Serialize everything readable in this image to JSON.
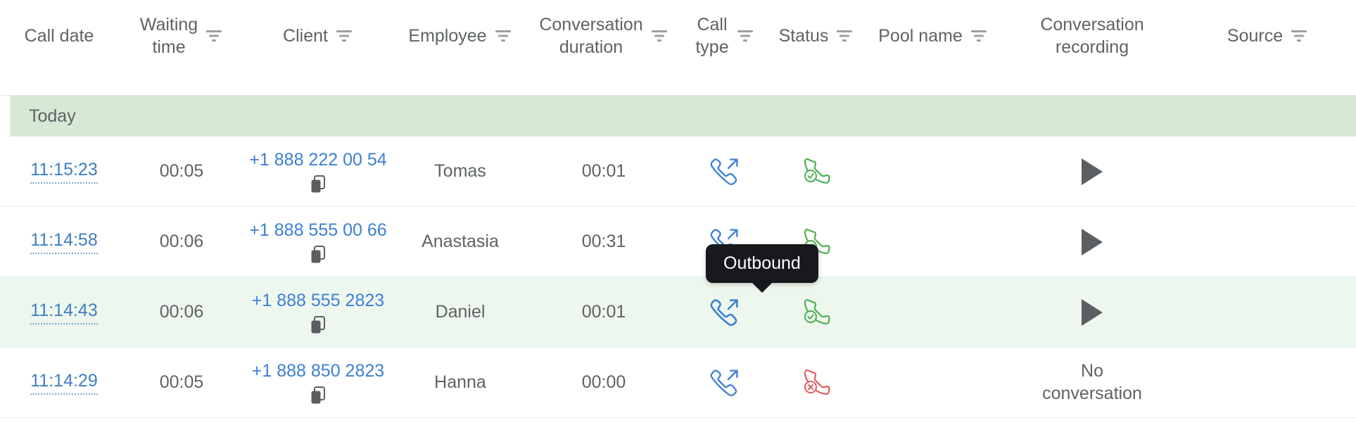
{
  "colors": {
    "link_blue": "#3d7fd4",
    "group_green": "#d7e9d5",
    "row_hover_green": "#eef7ee",
    "status_answered": "#4caf50",
    "status_missed": "#e25c5c",
    "text_gray": "#5e6366",
    "tooltip_bg": "#17191c"
  },
  "table": {
    "columns": [
      {
        "label": "Call date",
        "key": "call_date",
        "filter_icon": null,
        "filterable": false
      },
      {
        "label": "Waiting\ntime",
        "key": "waiting",
        "filter_icon": "filter-icon",
        "filterable": true
      },
      {
        "label": "Client",
        "key": "client",
        "filter_icon": "filter-icon",
        "filterable": true
      },
      {
        "label": "Employee",
        "key": "employee",
        "filter_icon": "filter-icon",
        "filterable": true
      },
      {
        "label": "Conversation\nduration",
        "key": "duration",
        "filter_icon": "filter-icon",
        "filterable": true
      },
      {
        "label": "Call\ntype",
        "key": "call_type",
        "filter_icon": "filter-icon",
        "filterable": true
      },
      {
        "label": "Status",
        "key": "status",
        "filter_icon": "filter-icon",
        "filterable": true
      },
      {
        "label": "Pool name",
        "key": "pool_name",
        "filter_icon": "filter-icon",
        "filterable": true
      },
      {
        "label": "Conversation\nrecording",
        "key": "recording",
        "filter_icon": null,
        "filterable": false
      },
      {
        "label": "Source",
        "key": "source",
        "filter_icon": "filter-icon",
        "filterable": true
      }
    ],
    "groups": [
      {
        "label": "Today"
      }
    ],
    "rows": [
      {
        "call_date": "11:15:23",
        "waiting": "00:05",
        "client": "+1 888 222 00 54",
        "copy_icon": "copy-icon",
        "employee": "Tomas",
        "duration": "00:01",
        "call_type_icon": "outbound-call-icon",
        "call_type_label": "Outbound",
        "status_icon": "call-answered-icon",
        "status_label": "Answered",
        "pool_name": "",
        "recording": "play-icon",
        "recording_text": "",
        "source": "",
        "highlighted": false
      },
      {
        "call_date": "11:14:58",
        "waiting": "00:06",
        "client": "+1 888 555 00 66",
        "copy_icon": "copy-icon",
        "employee": "Anastasia",
        "duration": "00:31",
        "call_type_icon": "outbound-call-icon",
        "call_type_label": "Outbound",
        "status_icon": "call-answered-icon",
        "status_label": "Answered",
        "pool_name": "",
        "recording": "play-icon",
        "recording_text": "",
        "source": "",
        "highlighted": false
      },
      {
        "call_date": "11:14:43",
        "waiting": "00:06",
        "client": "+1 888 555 2823",
        "copy_icon": "copy-icon",
        "employee": "Daniel",
        "duration": "00:01",
        "call_type_icon": "outbound-call-icon",
        "call_type_label": "Outbound",
        "status_icon": "call-answered-icon",
        "status_label": "Answered",
        "pool_name": "",
        "recording": "play-icon",
        "recording_text": "",
        "source": "",
        "highlighted": true
      },
      {
        "call_date": "11:14:29",
        "waiting": "00:05",
        "client": "+1 888 850 2823",
        "copy_icon": "copy-icon",
        "employee": "Hanna",
        "duration": "00:00",
        "call_type_icon": "outbound-call-icon",
        "call_type_label": "Outbound",
        "status_icon": "call-missed-icon",
        "status_label": "Missed",
        "pool_name": "",
        "recording": null,
        "recording_text": "No\nconversation",
        "source": "",
        "highlighted": false
      }
    ]
  },
  "tooltip": {
    "text": "Outbound",
    "visible": true
  }
}
